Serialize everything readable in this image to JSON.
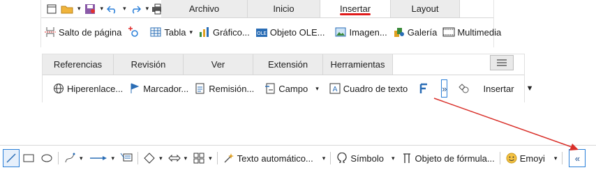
{
  "panel_top": {
    "tabs": [
      "Archivo",
      "Inicio",
      "Insertar",
      "Layout"
    ],
    "active_tab": "Insertar",
    "tools": [
      {
        "label": "Salto de página",
        "icon": "page-break-icon"
      },
      {
        "label": "",
        "icon": "field-icon"
      },
      {
        "label": "Tabla",
        "icon": "table-icon"
      },
      {
        "label": "Gráfico...",
        "icon": "chart-icon"
      },
      {
        "label": "Objeto OLE...",
        "icon": "ole-object-icon"
      },
      {
        "label": "Imagen...",
        "icon": "image-icon"
      },
      {
        "label": "Galería",
        "icon": "gallery-icon"
      },
      {
        "label": "Multimedia",
        "icon": "multimedia-icon"
      }
    ]
  },
  "panel_mid": {
    "tabs": [
      "Referencias",
      "Revisión",
      "Ver",
      "Extensión",
      "Herramientas"
    ],
    "tools": [
      {
        "label": "Hiperenlace...",
        "icon": "hyperlink-icon"
      },
      {
        "label": "Marcador...",
        "icon": "bookmark-icon"
      },
      {
        "label": "Remisión...",
        "icon": "cross-reference-icon"
      },
      {
        "label": "Campo",
        "icon": "field-icon"
      },
      {
        "label": "Cuadro de texto",
        "icon": "text-box-icon"
      },
      {
        "label": "",
        "icon": "fontwork-icon"
      },
      {
        "label": "Insertar",
        "icon": "shapes-icon"
      }
    ],
    "overflow_glyph": "»"
  },
  "panel_bottom": {
    "tools": [
      {
        "label": "Texto automático...",
        "icon": "autotext-icon"
      },
      {
        "label": "Símbolo",
        "icon": "omega-icon"
      },
      {
        "label": "Objeto de fórmula...",
        "icon": "formula-icon"
      },
      {
        "label": "Emoyi",
        "icon": "emoji-icon"
      }
    ],
    "overflow_glyph": "«"
  },
  "colors": {
    "accent": "#e01b1b",
    "selection": "#2a7fd8",
    "arrow": "#d9302a"
  }
}
